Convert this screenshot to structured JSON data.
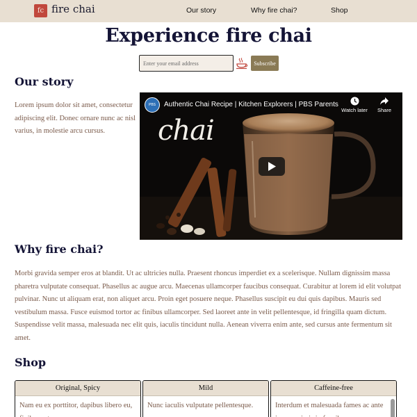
{
  "nav": {
    "logo_text": "fc",
    "brand": "fire chai",
    "links": [
      "Our story",
      "Why fire chai?",
      "Shop"
    ]
  },
  "hero": {
    "title": "Experience fire chai"
  },
  "subscribe": {
    "placeholder": "Enter your email address",
    "button_label": "Subscribe",
    "icon": "steaming-cup-icon"
  },
  "our_story": {
    "heading": "Our story",
    "text": "Lorem ipsum dolor sit amet, consectetur adipiscing elit. Donec ornare nunc ac nisl varius, in molestie arcu cursus."
  },
  "video": {
    "channel_badge": "PBS\nparents",
    "title": "Authentic Chai Recipe | Kitchen Explorers | PBS Parents",
    "watch_later_label": "Watch later",
    "share_label": "Share",
    "thumbnail_word": "chai"
  },
  "why": {
    "heading": "Why fire chai?",
    "text": "Morbi gravida semper eros at blandit. Ut ac ultricies nulla. Praesent rhoncus imperdiet ex a scelerisque. Nullam dignissim massa pharetra vulputate consequat. Phasellus ac augue arcu. Maecenas ullamcorper faucibus consequat. Curabitur at lorem id elit volutpat pulvinar. Nunc ut aliquam erat, non aliquet arcu. Proin eget posuere neque. Phasellus suscipit eu dui quis dapibus. Mauris sed vestibulum massa. Fusce euismod tortor ac finibus ullamcorper. Sed laoreet ante in velit pellentesque, id fringilla quam dictum. Suspendisse velit massa, malesuada nec elit quis, iaculis tincidunt nulla. Aenean viverra enim ante, sed cursus ante fermentum sit amet."
  },
  "shop": {
    "heading": "Shop",
    "cards": [
      {
        "title": "Original, Spicy",
        "text": "Nam eu ex porttitor, dapibus libero eu, finibus est."
      },
      {
        "title": "Mild",
        "text": "Nunc iaculis vulputate pellentesque."
      },
      {
        "title": "Caffeine-free",
        "text": "Interdum et malesuada fames ac ante ipsum primis in faucibus."
      }
    ]
  },
  "colors": {
    "nav_bg": "#e8dfd2",
    "heading": "#141436",
    "body_text": "#7a5a4a",
    "logo_red": "#c1483d",
    "subscribe_btn": "#8a7a55",
    "input_bg": "#f4eee7"
  }
}
